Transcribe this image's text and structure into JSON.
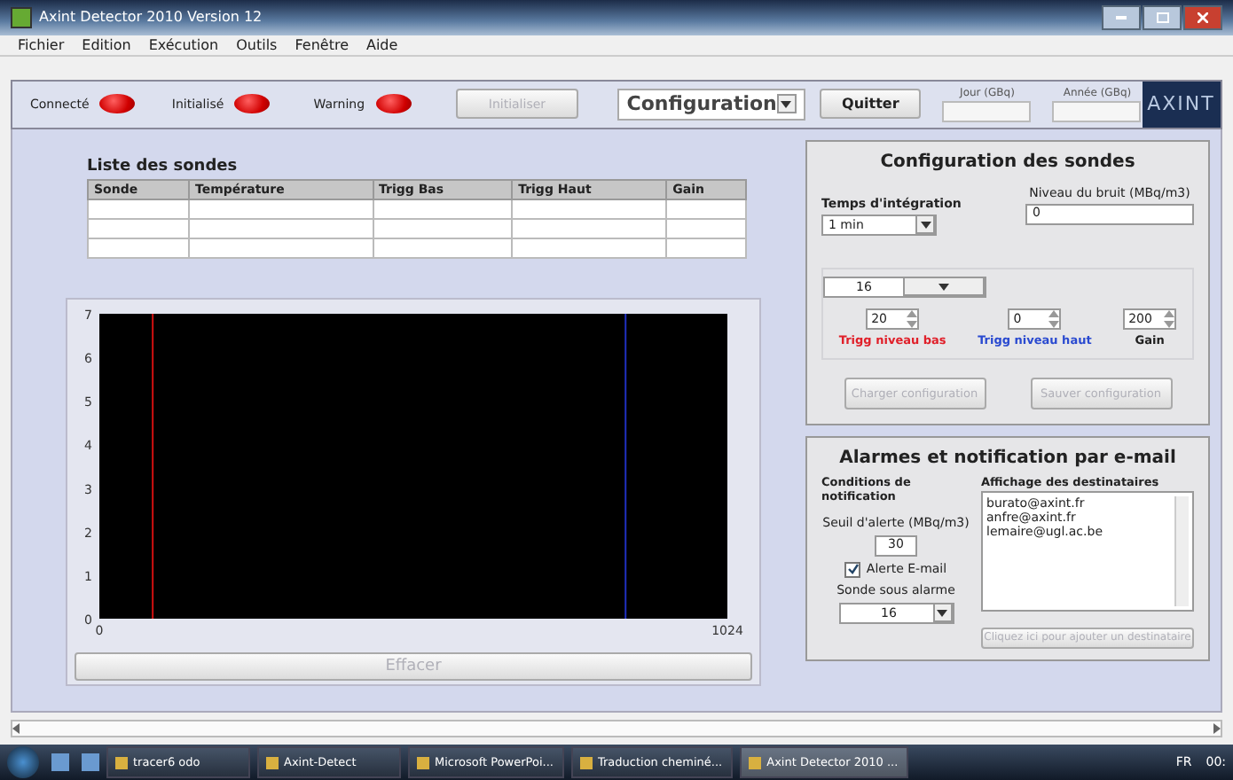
{
  "window": {
    "title": "Axint Detector 2010 Version 12"
  },
  "menu": [
    "Fichier",
    "Edition",
    "Exécution",
    "Outils",
    "Fenêtre",
    "Aide"
  ],
  "toolbar": {
    "indicators": [
      {
        "label": "Connecté",
        "on": true
      },
      {
        "label": "Initialisé",
        "on": true
      },
      {
        "label": "Warning",
        "on": true
      }
    ],
    "init_button": {
      "label": "Initialiser",
      "disabled": true
    },
    "mode_select": {
      "value": "Configuration"
    },
    "quit_button": {
      "label": "Quitter",
      "disabled": false
    },
    "fields": [
      {
        "label": "Jour (GBq)"
      },
      {
        "label": "Année (GBq)"
      }
    ],
    "logo": "AXINT"
  },
  "probe_list": {
    "title": "Liste des sondes",
    "columns": [
      "Sonde",
      "Température",
      "Trigg Bas",
      "Trigg Haut",
      "Gain"
    ]
  },
  "chart": {
    "chart_data": {
      "type": "line",
      "xlim": [
        0,
        1024
      ],
      "ylim": [
        0,
        7
      ],
      "xticks": [
        0,
        1024
      ],
      "yticks": [
        0,
        1,
        2,
        3,
        4,
        5,
        6,
        7
      ],
      "ref_lines": [
        {
          "axis": "x",
          "value": 87,
          "color": "#d01010"
        },
        {
          "axis": "x",
          "value": 858,
          "color": "#2030c0"
        }
      ]
    }
  },
  "clear_button": {
    "label": "Effacer",
    "disabled": true
  },
  "config": {
    "title": "Configuration des sondes",
    "integration": {
      "label": "Temps d'intégration",
      "value": "1 min"
    },
    "noise": {
      "label": "Niveau du bruit (MBq/m3)",
      "value": "0"
    },
    "probe_select": {
      "value": "16"
    },
    "spinners": [
      {
        "label": "Trigg niveau bas",
        "value": "20",
        "color": "#e0202a"
      },
      {
        "label": "Trigg niveau haut",
        "value": "0",
        "color": "#2a4ad0"
      },
      {
        "label": "Gain",
        "value": "200",
        "color": "#202020"
      }
    ],
    "buttons": [
      {
        "label": "Charger configuration",
        "disabled": true
      },
      {
        "label": "Sauver configuration",
        "disabled": true
      }
    ]
  },
  "alarms": {
    "title": "Alarmes et notification par e-mail",
    "conditions": {
      "title": "Conditions de notification",
      "threshold": {
        "label": "Seuil d'alerte (MBq/m3)",
        "value": "30"
      },
      "email_alert": {
        "label": "Alerte E-mail",
        "checked": true
      },
      "probe_alarm": {
        "label": "Sonde sous alarme",
        "value": "16"
      }
    },
    "recipients": {
      "title": "Affichage des destinataires",
      "items": [
        "burato@axint.fr",
        "anfre@axint.fr",
        "lemaire@ugl.ac.be"
      ]
    },
    "add_button": {
      "label": "Cliquez ici pour ajouter un destinataire",
      "disabled": true
    }
  },
  "taskbar": {
    "items": [
      {
        "label": "tracer6 odo",
        "selected": false
      },
      {
        "label": "Axint-Detect",
        "selected": false
      },
      {
        "label": "Microsoft PowerPoi...",
        "selected": false
      },
      {
        "label": "Traduction cheminé...",
        "selected": false
      },
      {
        "label": "Axint Detector 2010 ...",
        "selected": true
      }
    ],
    "language": "FR",
    "clock": "00:"
  }
}
